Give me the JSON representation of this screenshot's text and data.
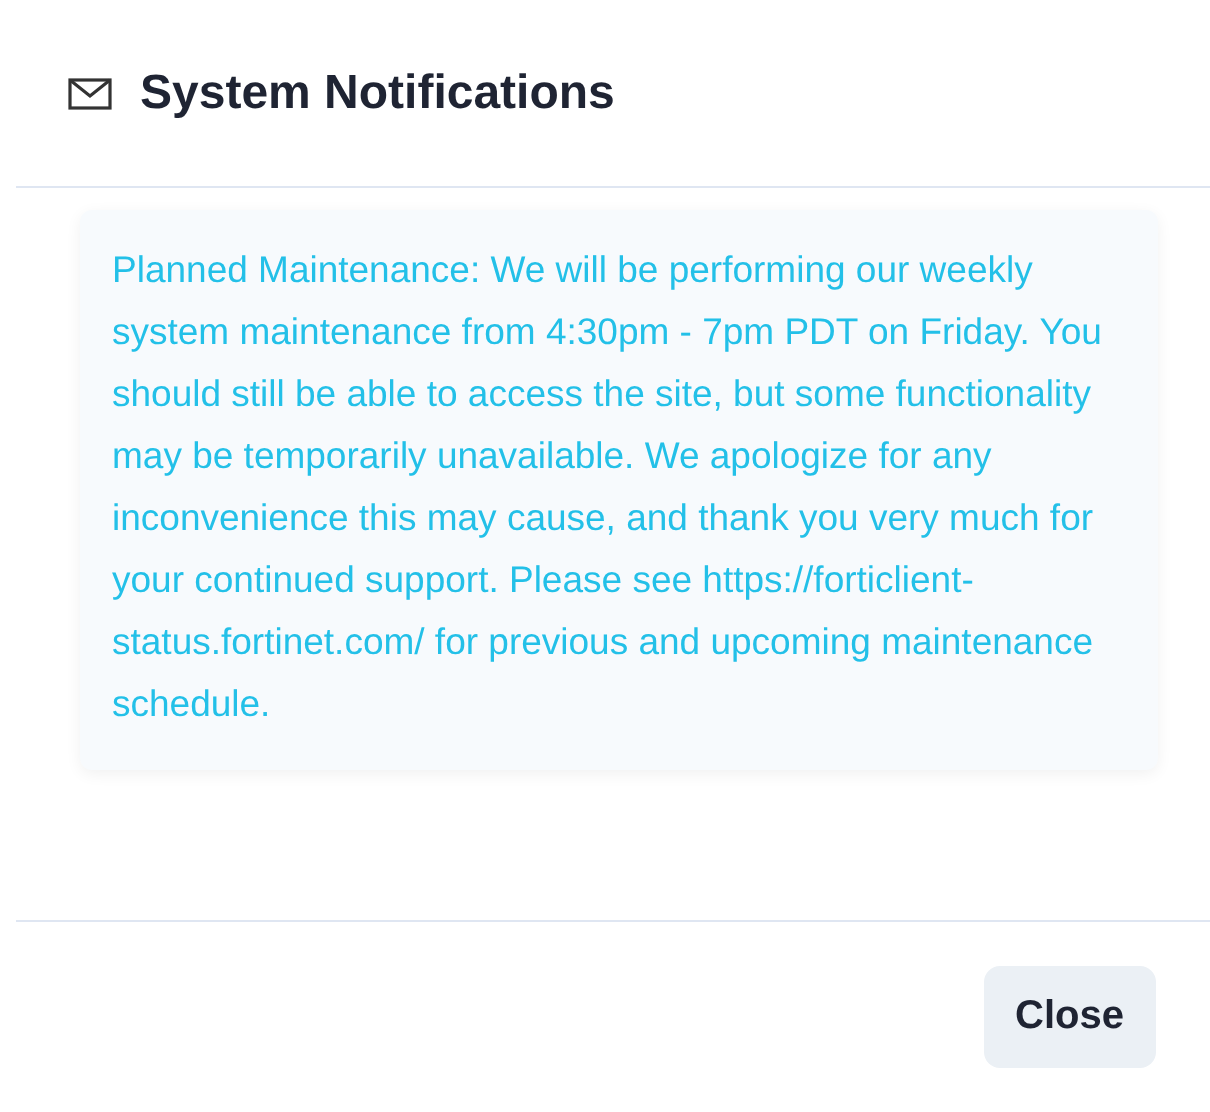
{
  "dialog": {
    "title": "System Notifications",
    "message": "Planned Maintenance: We will be performing our weekly system maintenance from 4:30pm - 7pm PDT on Friday. You should still be able to access the site, but some functionality may be temporarily unavailable. We apologize for any inconvenience this may cause, and thank you very much for your continued support. Please see https://forticlient-status.fortinet.com/ for previous and upcoming maintenance schedule.",
    "buttons": [
      "Close"
    ]
  }
}
